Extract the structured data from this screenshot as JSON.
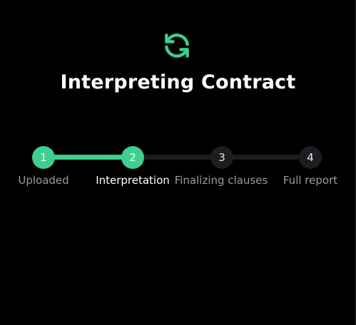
{
  "header": {
    "icon": "sync-icon",
    "title": "Interpreting Contract"
  },
  "colors": {
    "accent": "#3ecf8e",
    "inactive": "#1c1c21",
    "background": "#000000",
    "muted_text": "#9a9aa3"
  },
  "stepper": {
    "current_step": 2,
    "steps": [
      {
        "number": "1",
        "label": "Uploaded",
        "state": "done"
      },
      {
        "number": "2",
        "label": "Interpretation",
        "state": "active"
      },
      {
        "number": "3",
        "label": "Finalizing clauses",
        "state": "pending"
      },
      {
        "number": "4",
        "label": "Full report",
        "state": "pending"
      }
    ]
  }
}
